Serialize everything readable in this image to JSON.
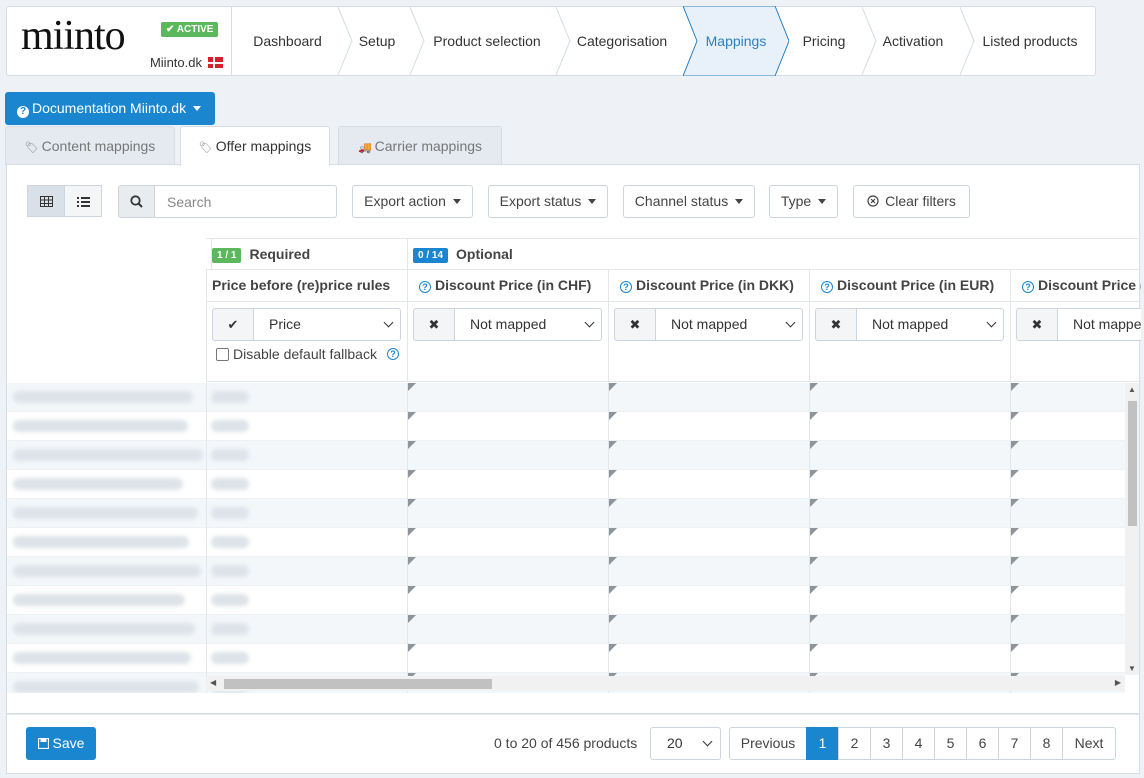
{
  "brand": {
    "logo_text": "miinto",
    "status_badge": "✔ ACTIVE",
    "site": "Miinto.dk"
  },
  "steps": [
    {
      "label": "Dashboard"
    },
    {
      "label": "Setup"
    },
    {
      "label": "Product selection"
    },
    {
      "label": "Categorisation"
    },
    {
      "label": "Mappings",
      "active": true
    },
    {
      "label": "Pricing"
    },
    {
      "label": "Activation"
    },
    {
      "label": "Listed products"
    }
  ],
  "documentation_button": "Documentation Miinto.dk",
  "tabs": [
    {
      "label": "Content mappings"
    },
    {
      "label": "Offer mappings",
      "active": true
    },
    {
      "label": "Carrier mappings"
    }
  ],
  "toolbar": {
    "search_placeholder": "Search",
    "filters": [
      "Export action",
      "Export status",
      "Channel status",
      "Type"
    ],
    "clear_filters": "Clear filters"
  },
  "groups": {
    "required": {
      "count": "1 / 1",
      "label": "Required"
    },
    "optional": {
      "count": "0 / 14",
      "label": "Optional"
    }
  },
  "columns": [
    {
      "label": "Price before (re)price rules",
      "value": "Price",
      "mapped": true,
      "fallback_label": "Disable default fallback"
    },
    {
      "label": "Discount Price (in CHF)",
      "value": "Not mapped",
      "mapped": false
    },
    {
      "label": "Discount Price (in DKK)",
      "value": "Not mapped",
      "mapped": false
    },
    {
      "label": "Discount Price (in EUR)",
      "value": "Not mapped",
      "mapped": false
    },
    {
      "label": "Discount Price (in",
      "value": "Not mappe",
      "mapped": false
    }
  ],
  "footer": {
    "save_label": "Save",
    "count_text": "0 to 20 of 456 products",
    "page_size": "20",
    "pagination": [
      "Previous",
      "1",
      "2",
      "3",
      "4",
      "5",
      "6",
      "7",
      "8",
      "Next"
    ],
    "current_page": "1"
  },
  "colors": {
    "accent": "#1a86d0",
    "active_badge": "#5cb85c",
    "optional_badge": "#1a86d0"
  }
}
